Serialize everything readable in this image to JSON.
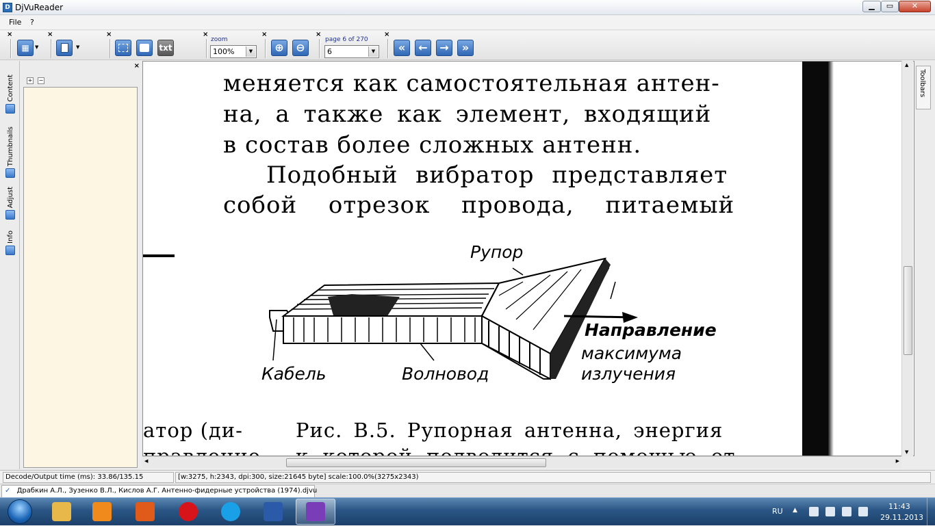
{
  "window": {
    "title": "DjVuReader",
    "minimize": "▁",
    "maximize": "▭",
    "close": "✕"
  },
  "menu": {
    "file": "File",
    "help": "?"
  },
  "toolbar": {
    "grip": "×",
    "zoom_label": "zoom",
    "zoom_value": "100%",
    "page_label": "page 6 of 270",
    "page_value": "6",
    "txt_label": "txt",
    "zoom_in": "⊕",
    "zoom_out": "⊖",
    "first": "«",
    "prev": "←",
    "next": "→",
    "last": "»"
  },
  "side_tabs": [
    "Content",
    "Thumbnails",
    "Adjust",
    "Info"
  ],
  "panel": {
    "close": "×",
    "expand": "+",
    "collapse": "−"
  },
  "right_tab": {
    "label": "Toolbars"
  },
  "page": {
    "lines": [
      "меняется как самостоятельная антен-",
      "на, а также как элемент, входящий",
      "в состав более сложных антенн.",
      "Подобный вибратор представляет",
      "собой отрезок провода, питаемый"
    ],
    "diagram_labels": {
      "horn": "Рупор",
      "direction": "Направление",
      "maximum": "максимума",
      "radiation": "излучения",
      "cable": "Кабель",
      "waveguide": "Волновод"
    },
    "caption_left_1": "атор (ди-",
    "caption_left_2": "правление",
    "caption_1": "Рис. В.5. Рупорная антенна, энергия",
    "caption_2": "к которой подводится с помощью от-"
  },
  "status": {
    "decode": "Decode/Output time (ms): 33.86/135.15",
    "info": "[w:3275, h:2343, dpi:300, size:21645 byte] scale:100.0%(3275x2343)"
  },
  "doc_tab": {
    "title": "Драбкин А.Л., Зузенко В.Л., Кислов А.Г. Антенно-фидерные устройства (1974).djvu"
  },
  "taskbar": {
    "lang": "RU",
    "time": "11:43",
    "date": "29.11.2013",
    "apps": [
      "explorer",
      "media-player",
      "paint",
      "opera",
      "skype",
      "word",
      "djvureader"
    ],
    "colors": {
      "explorer": "#e8b84a",
      "media-player": "#f08a1c",
      "paint": "#e05a1a",
      "opera": "#d8141b",
      "skype": "#1aa0e6",
      "word": "#2b5aa8",
      "djvureader": "#7a3db8"
    }
  }
}
